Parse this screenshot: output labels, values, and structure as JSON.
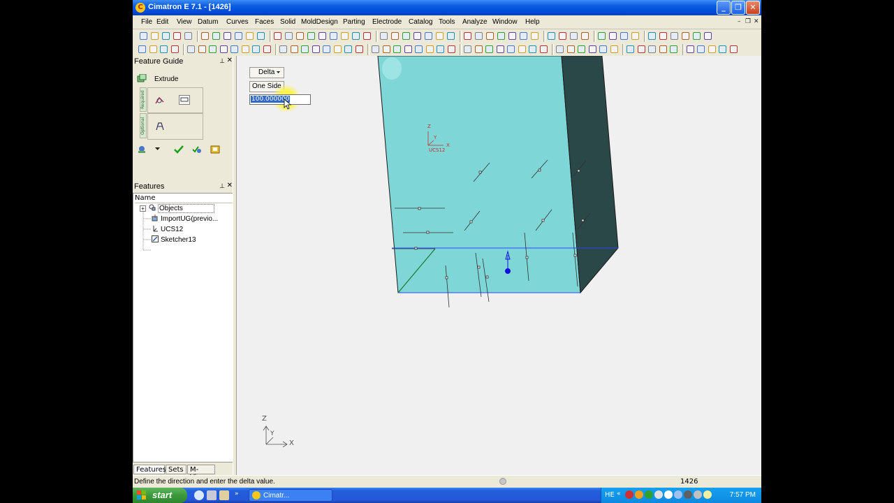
{
  "window": {
    "title": "Cimatron E 7.1 - [1426]",
    "app_icon_letter": "C",
    "minimize": "_",
    "maximize": "❐",
    "close": "✕"
  },
  "menubar": {
    "items": [
      "File",
      "Edit",
      "View",
      "Datum",
      "Curves",
      "Faces",
      "Solid",
      "MoldDesign",
      "Parting",
      "Electrode",
      "Catalog",
      "Tools",
      "Analyze",
      "Window",
      "Help"
    ],
    "mdi_min": "–",
    "mdi_restore": "❐",
    "mdi_close": "✕"
  },
  "feature_guide": {
    "title": "Feature Guide",
    "pin": "⊥",
    "close": "✕",
    "feature_name": "Extrude",
    "required_label": "Required",
    "optional_label": "Optional"
  },
  "features_panel": {
    "title": "Features",
    "pin": "⊥",
    "close": "✕",
    "column_name": "Name",
    "tree": [
      {
        "label": "Objects",
        "expander": "+"
      },
      {
        "label": "ImportUG(previo..."
      },
      {
        "label": "UCS12"
      },
      {
        "label": "Sketcher13"
      }
    ]
  },
  "bottom_tabs": [
    "Features",
    "Sets",
    "M-View"
  ],
  "viewport": {
    "mode_dropdown": "Delta",
    "side_button": "One Side",
    "delta_value": "100.000000",
    "ucs_label": "UCS12",
    "ucs_z": "Z",
    "ucs_x": "X",
    "ucs_y": "Y",
    "triad_z": "Z",
    "triad_x": "X",
    "triad_y": "Y",
    "colors": {
      "face_front": "#7fd6d6",
      "face_side": "#2b4848",
      "edge": "#1a1a1a",
      "highlight": "#0000ff"
    }
  },
  "statusbar": {
    "message": "Define the direction and enter the delta value.",
    "number": "1426"
  },
  "taskbar": {
    "start_label": "start",
    "task_label": "Cimatr...",
    "language": "HE",
    "clock": "7:57 PM"
  }
}
